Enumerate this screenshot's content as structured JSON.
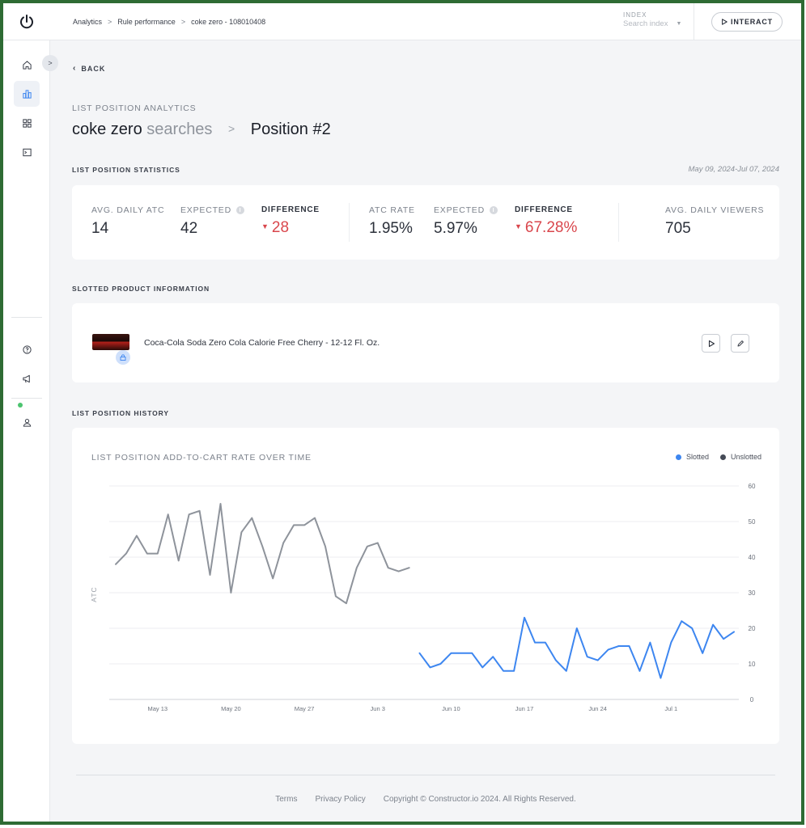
{
  "breadcrumb": [
    "Analytics",
    "Rule performance",
    "coke zero - 108010408"
  ],
  "index": {
    "label": "INDEX",
    "placeholder": "Search index"
  },
  "interact_label": "INTERACT",
  "back_label": "BACK",
  "overline": "LIST POSITION ANALYTICS",
  "title": {
    "query": "coke zero",
    "suffix": "searches",
    "position": "Position #2"
  },
  "stats_section": {
    "heading": "LIST POSITION STATISTICS",
    "date_range": "May 09, 2024-Jul 07, 2024",
    "items": [
      {
        "label": "AVG. DAILY ATC",
        "value": "14"
      },
      {
        "label": "EXPECTED",
        "value": "42"
      },
      {
        "label": "DIFFERENCE",
        "value": "28"
      },
      {
        "label": "ATC RATE",
        "value": "1.95%"
      },
      {
        "label": "EXPECTED",
        "value": "5.97%"
      },
      {
        "label": "DIFFERENCE",
        "value": "67.28%"
      },
      {
        "label": "AVG. DAILY VIEWERS",
        "value": "705"
      }
    ],
    "negative_color": "#d9464c"
  },
  "product_section": {
    "heading": "SLOTTED PRODUCT INFORMATION",
    "product_name": "Coca-Cola Soda Zero Cola Calorie Free Cherry - 12-12 Fl. Oz."
  },
  "history_section": {
    "heading": "LIST POSITION HISTORY"
  },
  "chart_data": {
    "type": "line",
    "title": "LIST POSITION ADD-TO-CART RATE OVER TIME",
    "ylabel": "ATC",
    "xlabel": "",
    "ylim": [
      0,
      60
    ],
    "yticks": [
      0,
      10,
      20,
      30,
      40,
      50,
      60
    ],
    "x_tick_labels": [
      "May 13",
      "May 20",
      "May 27",
      "Jun 3",
      "Jun 10",
      "Jun 17",
      "Jun 24",
      "Jul 1"
    ],
    "grid": true,
    "legend_placement": "top-right",
    "series": [
      {
        "name": "Unslotted",
        "color": "#8e939b",
        "start_index": 0,
        "values": [
          38,
          41,
          46,
          41,
          41,
          52,
          39,
          52,
          53,
          35,
          55,
          30,
          47,
          51,
          43,
          34,
          44,
          49,
          49,
          51,
          43,
          29,
          27,
          37,
          43,
          44,
          37,
          36,
          37
        ]
      },
      {
        "name": "Slotted",
        "color": "#3d86f0",
        "start_index": 29,
        "values": [
          13,
          9,
          10,
          13,
          13,
          13,
          9,
          12,
          8,
          8,
          23,
          16,
          16,
          11,
          8,
          20,
          12,
          11,
          14,
          15,
          15,
          8,
          16,
          6,
          16,
          22,
          20,
          13,
          21,
          17,
          19
        ]
      }
    ]
  },
  "footer": {
    "terms": "Terms",
    "privacy": "Privacy Policy",
    "copyright": "Copyright © Constructor.io 2024. All Rights Reserved."
  }
}
